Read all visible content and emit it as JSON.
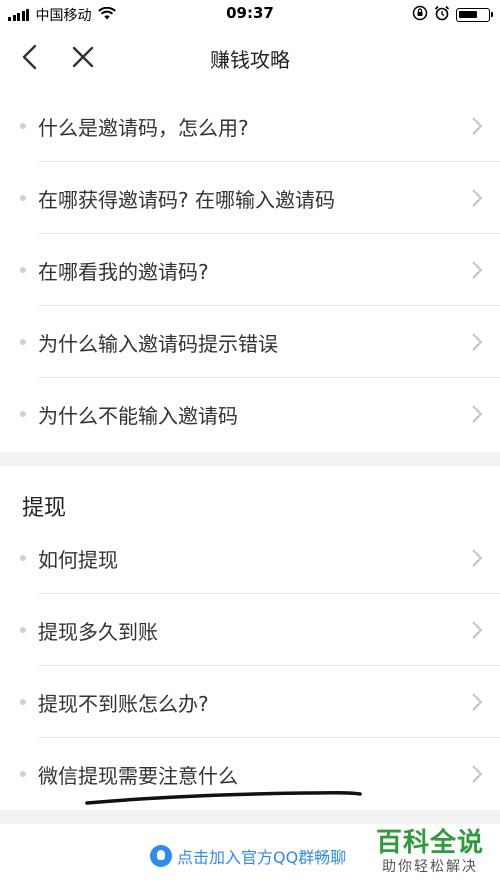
{
  "status_bar": {
    "carrier": "中国移动",
    "time": "09:37"
  },
  "nav": {
    "title": "赚钱攻略"
  },
  "invite_section": {
    "items": [
      {
        "label": "什么是邀请码，怎么用?"
      },
      {
        "label": "在哪获得邀请码? 在哪输入邀请码"
      },
      {
        "label": "在哪看我的邀请码?"
      },
      {
        "label": "为什么输入邀请码提示错误"
      },
      {
        "label": "为什么不能输入邀请码"
      }
    ]
  },
  "withdraw_section": {
    "title": "提现",
    "items": [
      {
        "label": "如何提现"
      },
      {
        "label": "提现多久到账"
      },
      {
        "label": "提现不到账怎么办?"
      },
      {
        "label": "微信提现需要注意什么"
      }
    ]
  },
  "footer": {
    "link_text": "点击加入官方QQ群畅聊"
  },
  "watermark": {
    "title": "百科全说",
    "subtitle": "助你轻松解决"
  },
  "colors": {
    "accent": "#2e8bf0",
    "watermark": "#2e9b3c",
    "divider": "#f2f2f2"
  }
}
